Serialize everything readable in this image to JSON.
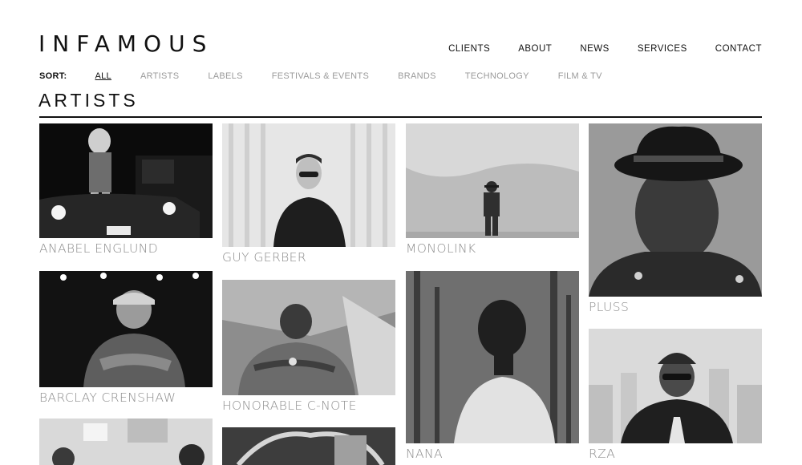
{
  "brand": {
    "logo": "INFAMOUS"
  },
  "nav": {
    "clients": "CLIENTS",
    "about": "ABOUT",
    "news": "NEWS",
    "services": "SERVICES",
    "contact": "CONTACT"
  },
  "sort": {
    "label": "SORT:",
    "selected": "ALL",
    "options": [
      "ALL",
      "ARTISTS",
      "LABELS",
      "FESTIVALS & EVENTS",
      "BRANDS",
      "TECHNOLOGY",
      "FILM & TV"
    ]
  },
  "page": {
    "title": "ARTISTS"
  },
  "artists": [
    {
      "name": "ANABEL ENGLUND"
    },
    {
      "name": "GUY GERBER"
    },
    {
      "name": "MONOLINK"
    },
    {
      "name": "PLUSS"
    },
    {
      "name": "BARCLAY CRENSHAW"
    },
    {
      "name": "HONORABLE C-NOTE"
    },
    {
      "name": "NANA"
    },
    {
      "name": "RZA"
    },
    {
      "name": ""
    },
    {
      "name": ""
    }
  ]
}
